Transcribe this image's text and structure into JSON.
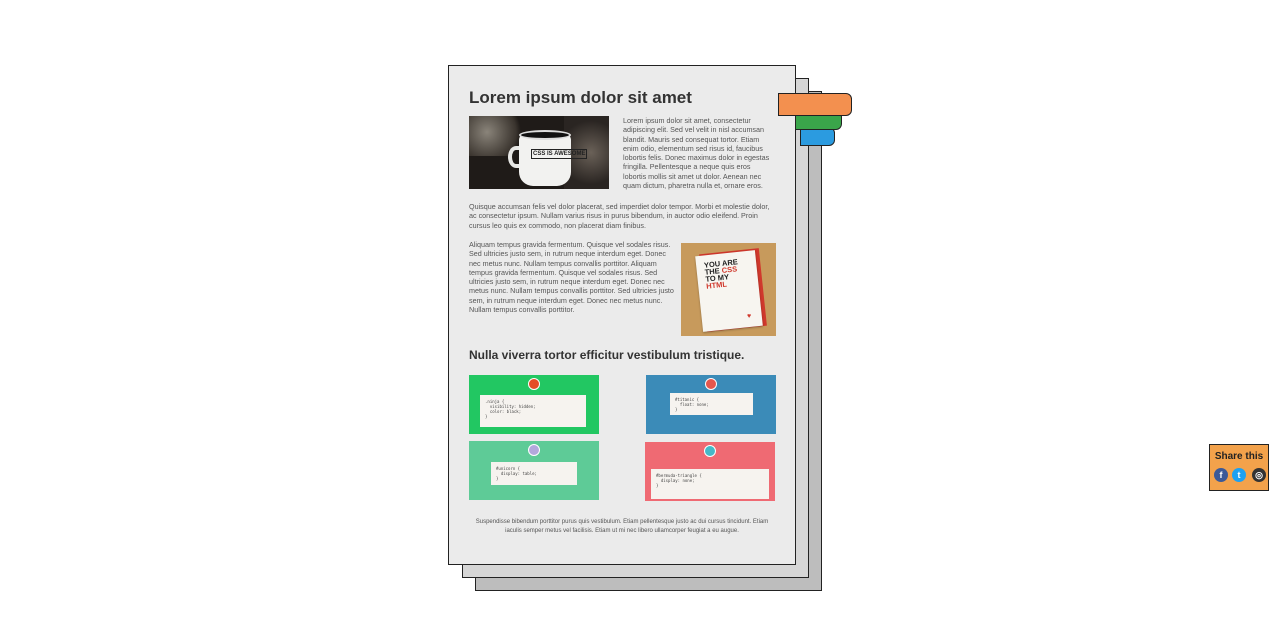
{
  "page": {
    "title": "Lorem ipsum dolor sit amet",
    "paragraph_1": "Lorem ipsum dolor sit amet, consectetur adipiscing elit. Sed vel velit in nisl accumsan blandit. Mauris sed consequat tortor. Etiam enim odio, elementum sed risus id, faucibus lobortis felis. Donec maximus dolor in egestas fringilla. Pellentesque a neque quis eros lobortis mollis sit amet ut dolor. Aenean nec quam dictum, pharetra nulla et, ornare eros.",
    "paragraph_2": "Quisque accumsan felis vel dolor placerat, sed imperdiet dolor tempor. Morbi et molestie dolor, ac consectetur ipsum. Nullam varius risus in purus bibendum, in auctor odio eleifend. Proin cursus leo quis ex commodo, non placerat diam finibus.",
    "paragraph_3": "Aliquam tempus gravida fermentum. Quisque vel sodales risus. Sed ultricies justo sem, in rutrum neque interdum eget. Donec nec metus nunc. Nullam tempus convallis porttitor. Aliquam tempus gravida fermentum. Quisque vel sodales risus. Sed ultricies justo sem, in rutrum neque interdum eget. Donec nec metus nunc. Nullam tempus convallis porttitor. Sed ultricies justo sem, in rutrum neque interdum eget. Donec nec metus nunc. Nullam tempus convallis porttitor.",
    "subtitle": "Nulla viverra tortor efficitur vestibulum tristique.",
    "footer_text": "Suspendisse bibendum porttitor purus quis vestibulum. Etiam pellentesque justo ac dui cursus tincidunt. Etiam iaculis semper metus vel facilisis. Etiam ut mi nec libero ullamcorper feugiat a eu augue."
  },
  "images": {
    "mug_text": "CSS IS AWESOME",
    "card_line1": "YOU ARE",
    "card_line2_prefix": "THE ",
    "card_line2_highlight": "CSS",
    "card_line3": "TO MY",
    "card_line4": "HTML"
  },
  "tiles": [
    {
      "code": ".ninja {\n  visibility: hidden;\n  color: black;\n}",
      "color": "#22c762",
      "icon": "ninja-icon"
    },
    {
      "code": "#titanic {\n  float: none;\n}",
      "color": "#3b8bb8",
      "icon": "ship-icon"
    },
    {
      "code": "#unicorn {\n  display: table;\n}",
      "color": "#5ecb97",
      "icon": "unicorn-icon"
    },
    {
      "code": "#bermuda-triangle {\n  display: none;\n}",
      "color": "#ef6a73",
      "icon": "plane-icon"
    }
  ],
  "tabs": [
    {
      "color": "#f3904f",
      "name": "orange"
    },
    {
      "color": "#3aa54a",
      "name": "green"
    },
    {
      "color": "#2b9be0",
      "name": "blue"
    }
  ],
  "share": {
    "title": "Share this",
    "icons": [
      "facebook-icon",
      "twitter-icon",
      "instagram-icon"
    ]
  }
}
